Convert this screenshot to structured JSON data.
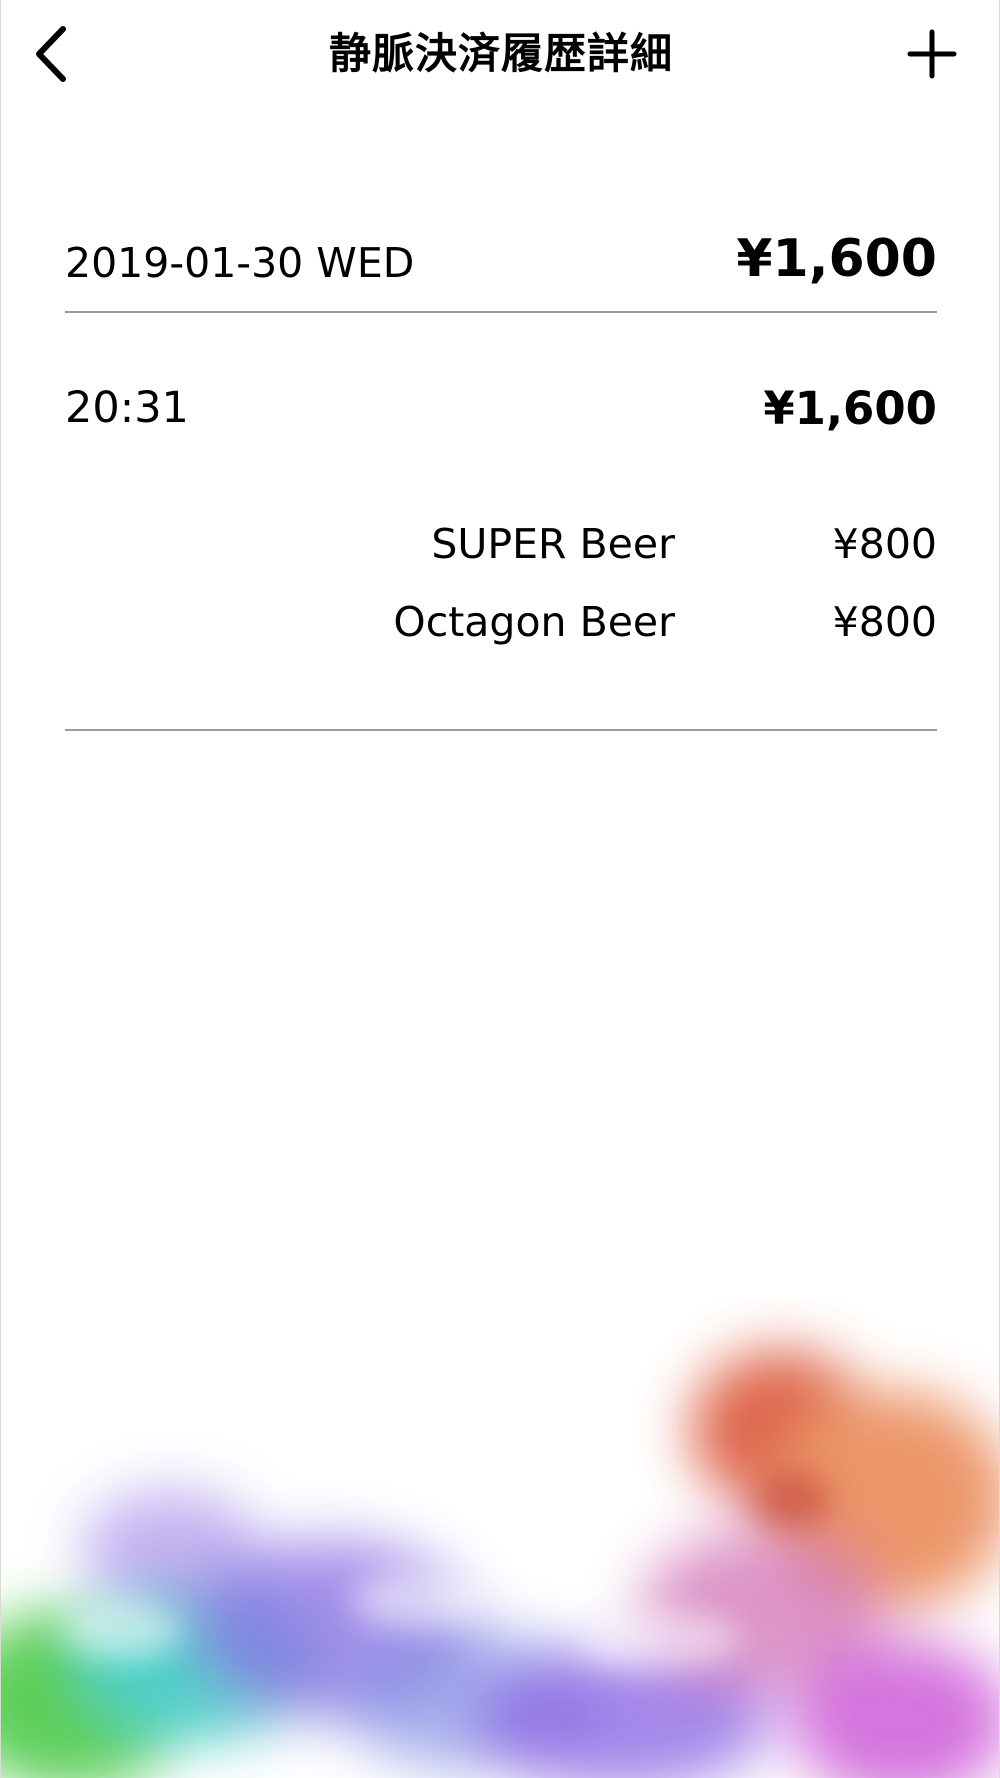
{
  "header": {
    "title": "静脈決済履歴詳細",
    "back_icon": "chevron-left-icon",
    "add_icon": "plus-icon"
  },
  "day": {
    "date": "2019-01-30 WED",
    "total": "¥1,600"
  },
  "transactions": [
    {
      "time": "20:31",
      "amount": "¥1,600",
      "items": [
        {
          "name": "SUPER Beer",
          "price": "¥800"
        },
        {
          "name": "Octagon Beer",
          "price": "¥800"
        }
      ]
    }
  ],
  "decoration": {
    "colors": [
      "#3fc63a",
      "#2ec8c0",
      "#7a5be0",
      "#9a7fe6",
      "#d84a2a",
      "#e8834f",
      "#c43fd0"
    ]
  }
}
